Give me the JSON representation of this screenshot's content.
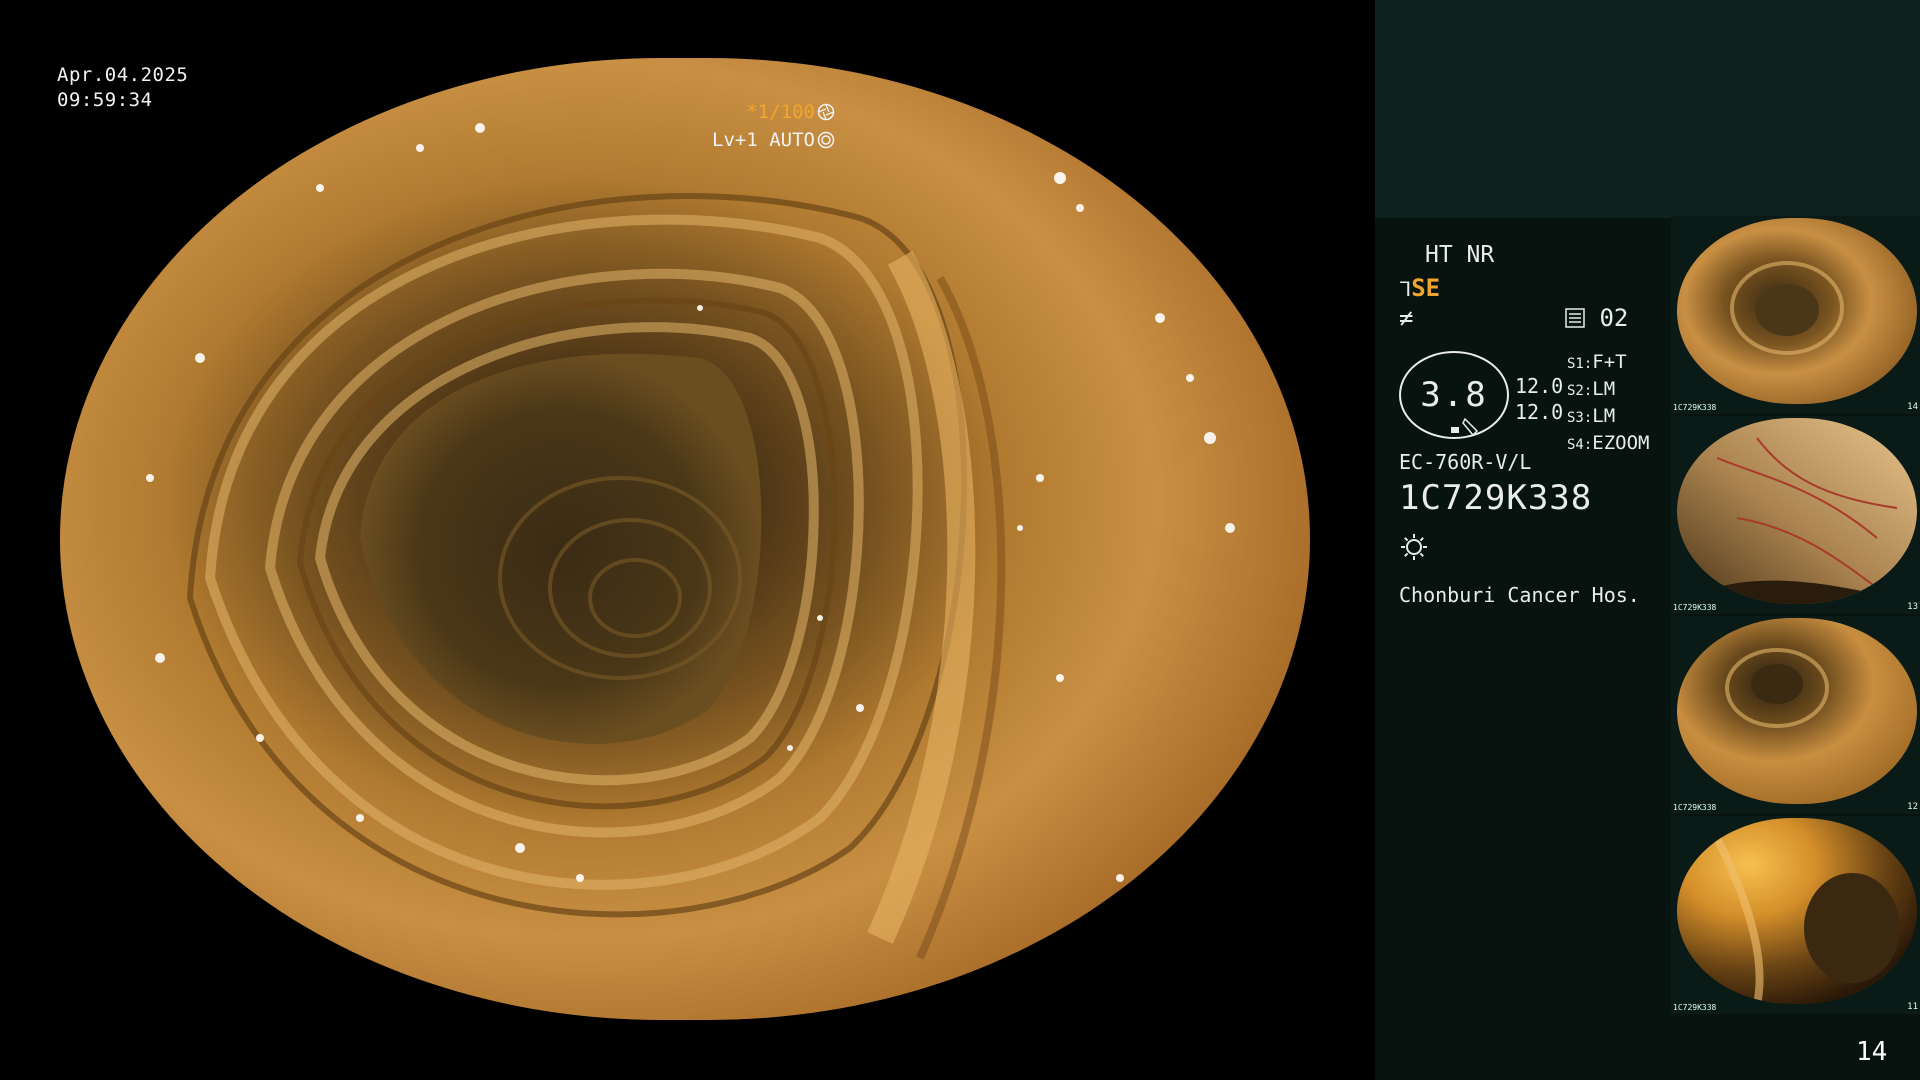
{
  "osd": {
    "date": "Apr.04.2025",
    "time": "09:59:34",
    "shutter": "*1/100",
    "iris": "Lv+1 AUTO"
  },
  "panel": {
    "ht_nr": "HT NR",
    "se": "SE",
    "memory": "02",
    "zoom_value": "3.8",
    "zoom_a": "12.0",
    "zoom_b": "12.0",
    "switches": [
      {
        "key": "S1:",
        "value": "F+T"
      },
      {
        "key": "S2:",
        "value": "LM"
      },
      {
        "key": "S3:",
        "value": "LM"
      },
      {
        "key": "S4:",
        "value": "EZOOM"
      }
    ],
    "scope_model": "EC-760R-V/L",
    "scope_serial": "1C729K338",
    "hospital": "Chonburi Cancer Hos."
  },
  "thumbnails": [
    {
      "caption": "1C729K338",
      "number": "14"
    },
    {
      "caption": "1C729K338",
      "number": "13"
    },
    {
      "caption": "1C729K338",
      "number": "12"
    },
    {
      "caption": "1C729K338",
      "number": "11"
    }
  ],
  "page_number": "14",
  "colors": {
    "accent": "#f2a52e",
    "panel_bg": "#07130f",
    "panel_header": "#0e2220",
    "mucosa": "#c58a3a"
  }
}
